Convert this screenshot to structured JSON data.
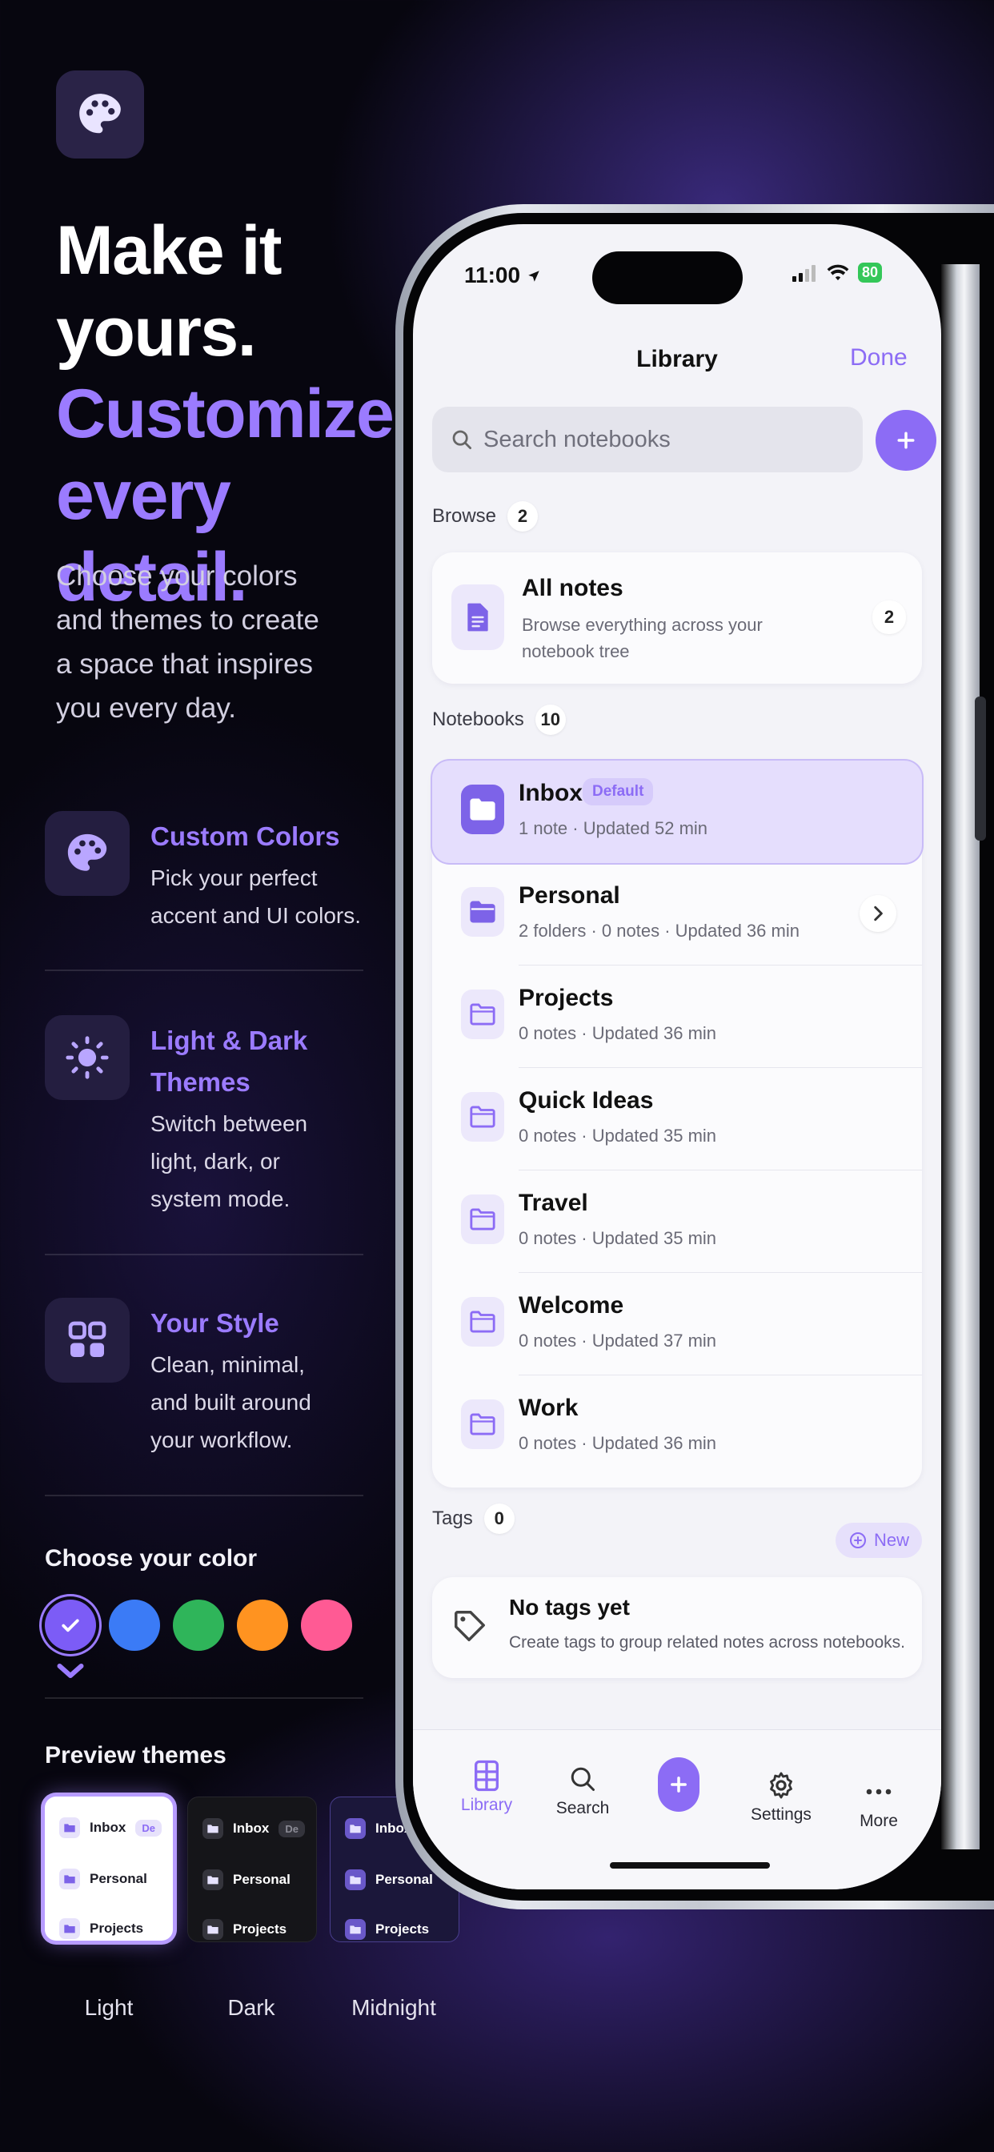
{
  "marketing": {
    "headline_white": [
      "Make it",
      "yours."
    ],
    "headline_purple": [
      "Customize",
      "every detail."
    ],
    "lead": [
      "Choose your colors",
      "and themes to create",
      "a space that inspires",
      "you every day."
    ],
    "features": [
      {
        "title": "Custom Colors",
        "desc": [
          "Pick your perfect",
          "accent and UI colors."
        ],
        "icon": "palette-icon"
      },
      {
        "title_lines": [
          "Light & Dark",
          "Themes"
        ],
        "desc": [
          "Switch between",
          "light, dark, or",
          "system mode."
        ],
        "icon": "sun-icon"
      },
      {
        "title": "Your Style",
        "desc": [
          "Clean, minimal,",
          "and built around",
          "your workflow."
        ],
        "icon": "grid-icon"
      }
    ],
    "choose_color_label": "Choose your color",
    "color_swatches": [
      "#7c5cf6",
      "#3b7bf6",
      "#2fb55a",
      "#ff9320",
      "#ff5a94"
    ],
    "preview_themes_label": "Preview themes",
    "themes": [
      {
        "name": "Light",
        "bg": "#ffffff",
        "fg": "#1d1d27",
        "icon_bg": "#e7e2fb",
        "tag_bg": "#e7e2fb",
        "tag_fg": "#8c6cf5"
      },
      {
        "name": "Dark",
        "bg": "#151519",
        "fg": "#ffffff",
        "icon_bg": "#34343c",
        "tag_bg": "#34343c",
        "tag_fg": "#8b8b95"
      },
      {
        "name": "Midnight",
        "bg": "#1b173a",
        "fg": "#ffffff",
        "icon_bg": "#6a58c9",
        "tag_bg": "#5a4bb0",
        "tag_fg": "#d9d2ff"
      }
    ],
    "theme_rows": [
      "Inbox",
      "Personal",
      "Projects"
    ],
    "theme_tag": "De"
  },
  "phone": {
    "status_time": "11:00",
    "battery": "80",
    "nav_title": "Library",
    "done_label": "Done",
    "search_placeholder": "Search notebooks",
    "browse_label": "Browse",
    "browse_count": "2",
    "all_notes": {
      "title": "All notes",
      "desc": [
        "Browse everything across your",
        "notebook tree"
      ],
      "count": "2"
    },
    "notebooks_label": "Notebooks",
    "notebooks_count": "10",
    "default_tag": "Default",
    "notebooks": [
      {
        "name": "Inbox",
        "meta": "1 note · Updated 52 min"
      },
      {
        "name": "Personal",
        "meta": "2 folders · 0 notes · Updated 36 min"
      },
      {
        "name": "Projects",
        "meta": "0 notes · Updated 36 min"
      },
      {
        "name": "Quick Ideas",
        "meta": "0 notes · Updated 35 min"
      },
      {
        "name": "Travel",
        "meta": "0 notes · Updated 35 min"
      },
      {
        "name": "Welcome",
        "meta": "0 notes · Updated 37 min"
      },
      {
        "name": "Work",
        "meta": "0 notes · Updated 36 min"
      }
    ],
    "tags_label": "Tags",
    "tags_count": "0",
    "new_label": "New",
    "no_tags_title": "No tags yet",
    "no_tags_desc": "Create tags to group related notes across notebooks.",
    "tabs": [
      "Library",
      "Search",
      "Settings",
      "More"
    ],
    "accent": "#8c6cf5"
  }
}
